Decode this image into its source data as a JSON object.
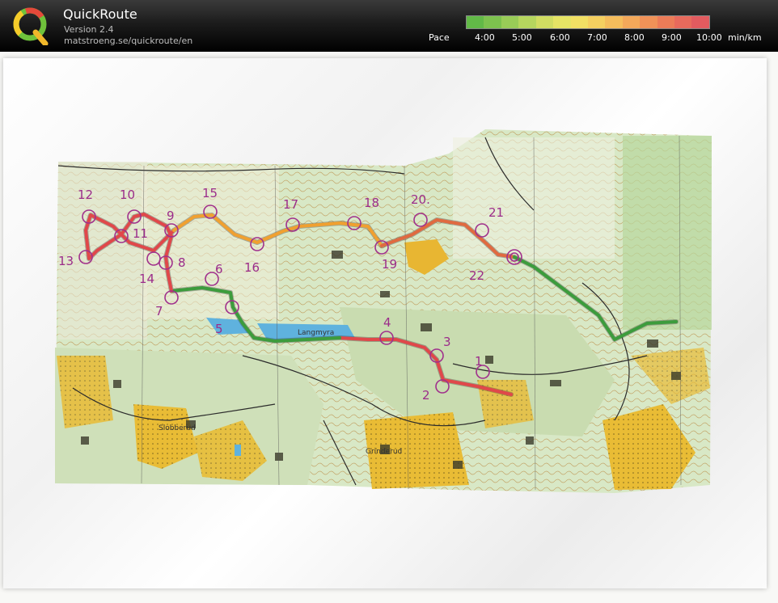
{
  "app": {
    "title": "QuickRoute",
    "version": "Version 2.4",
    "url": "matstroeng.se/quickroute/en"
  },
  "pace_legend": {
    "label": "Pace",
    "ticks": [
      "4:00",
      "5:00",
      "6:00",
      "7:00",
      "8:00",
      "9:00",
      "10:00"
    ],
    "unit": "min/km",
    "colors": [
      "#62b947",
      "#7dc24e",
      "#99cc57",
      "#b6d65e",
      "#d1dd62",
      "#e6e465",
      "#f2e064",
      "#f5d060",
      "#f5bd5c",
      "#f3a85a",
      "#f09258",
      "#ec7c58",
      "#e86a5c",
      "#e25b5f"
    ]
  },
  "map": {
    "controls": [
      {
        "num": "1"
      },
      {
        "num": "2"
      },
      {
        "num": "3"
      },
      {
        "num": "4"
      },
      {
        "num": "5"
      },
      {
        "num": "6"
      },
      {
        "num": "7"
      },
      {
        "num": "8"
      },
      {
        "num": "9"
      },
      {
        "num": "10"
      },
      {
        "num": "11"
      },
      {
        "num": "12"
      },
      {
        "num": "13"
      },
      {
        "num": "14"
      },
      {
        "num": "15"
      },
      {
        "num": "16"
      },
      {
        "num": "17"
      },
      {
        "num": "18"
      },
      {
        "num": "19"
      },
      {
        "num": "20."
      },
      {
        "num": "21"
      },
      {
        "num": "22"
      }
    ],
    "place_names": [
      "Langmyra",
      "Slobberud",
      "Grinderud"
    ],
    "colors": {
      "route_red": "#e0484a",
      "route_orange": "#f0a030",
      "route_green": "#3c9c3c",
      "control_purple": "#a0308c",
      "water": "#5fb2de",
      "field": "#e8b830",
      "forest": "#cfe3b4"
    }
  }
}
